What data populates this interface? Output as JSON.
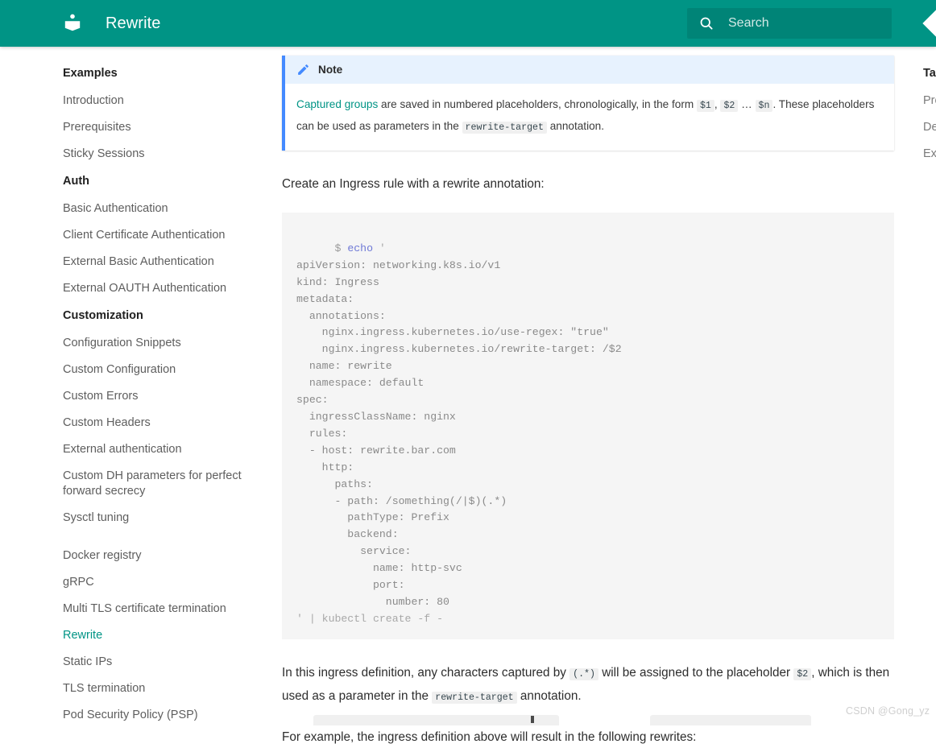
{
  "header": {
    "logo_icon": "book-icon",
    "title": "Rewrite",
    "search": {
      "icon": "search-icon",
      "placeholder": "Search",
      "value": ""
    },
    "nav_arrow_icon": "chevron-left-icon",
    "background_color": "#009485"
  },
  "sidebar": {
    "groups": [
      {
        "title": "Examples",
        "items": [
          {
            "label": "Introduction",
            "active": false
          },
          {
            "label": "Prerequisites",
            "active": false
          },
          {
            "label": "Sticky Sessions",
            "active": false
          }
        ]
      },
      {
        "title": "Auth",
        "items": [
          {
            "label": "Basic Authentication",
            "active": false
          },
          {
            "label": "Client Certificate Authentication",
            "active": false
          },
          {
            "label": "External Basic Authentication",
            "active": false
          },
          {
            "label": "External OAUTH Authentication",
            "active": false
          }
        ]
      },
      {
        "title": "Customization",
        "items": [
          {
            "label": "Configuration Snippets",
            "active": false
          },
          {
            "label": "Custom Configuration",
            "active": false
          },
          {
            "label": "Custom Errors",
            "active": false
          },
          {
            "label": "Custom Headers",
            "active": false
          },
          {
            "label": "External authentication",
            "active": false
          },
          {
            "label": "Custom DH parameters for perfect forward secrecy",
            "active": false
          },
          {
            "label": "Sysctl tuning",
            "active": false
          }
        ]
      },
      {
        "title": "",
        "items": [
          {
            "label": "Docker registry",
            "active": false
          },
          {
            "label": "gRPC",
            "active": false
          },
          {
            "label": "Multi TLS certificate termination",
            "active": false
          },
          {
            "label": "Rewrite",
            "active": true
          },
          {
            "label": "Static IPs",
            "active": false
          },
          {
            "label": "TLS termination",
            "active": false
          },
          {
            "label": "Pod Security Policy (PSP)",
            "active": false
          }
        ]
      }
    ],
    "active_color": "#009485"
  },
  "note": {
    "icon": "pencil-icon",
    "title": "Note",
    "accent_color": "#448aff",
    "header_bg": "#e7f2fe",
    "link_text": "Captured groups",
    "text_1": " are saved in numbered placeholders, chronologically, in the form ",
    "code_1": "$1",
    "sep_1": ", ",
    "code_2": "$2",
    "sep_2": " … ",
    "code_3": "$n",
    "text_2": ". These placeholders can be used as parameters in the ",
    "code_4": "rewrite-target",
    "text_3": " annotation."
  },
  "main": {
    "intro_paragraph": "Create an Ingress rule with a rewrite annotation:",
    "code_block": {
      "copy_icon": "copy-icon",
      "prompt": "$",
      "command": "echo",
      "quote": "'",
      "lines": [
        "apiVersion: networking.k8s.io/v1",
        "kind: Ingress",
        "metadata:",
        "  annotations:",
        "    nginx.ingress.kubernetes.io/use-regex: \"true\"",
        "    nginx.ingress.kubernetes.io/rewrite-target: /$2",
        "  name: rewrite",
        "  namespace: default",
        "spec:",
        "  ingressClassName: nginx",
        "  rules:",
        "  - host: rewrite.bar.com",
        "    http:",
        "      paths:",
        "      - path: /something(/|$)(.*)",
        "        pathType: Prefix",
        "        backend:",
        "          service:",
        "            name: http-svc",
        "            port:",
        "              number: 80"
      ],
      "closing_line": "' | kubectl create -f -"
    },
    "paragraph_2": {
      "text_1": "In this ingress definition, any characters captured by ",
      "code_1": "(.*)",
      "text_2": " will be assigned to the placeholder ",
      "code_2": "$2",
      "text_3": ", which is then used as a parameter in the ",
      "code_3": "rewrite-target",
      "text_4": " annotation."
    },
    "paragraph_3": "For example, the ingress definition above will result in the following rewrites:"
  },
  "toc": {
    "title": "Table of contents",
    "items": [
      "Prerequisites",
      "Deployment",
      "Examples"
    ]
  },
  "watermark": "CSDN @Gong_yz"
}
